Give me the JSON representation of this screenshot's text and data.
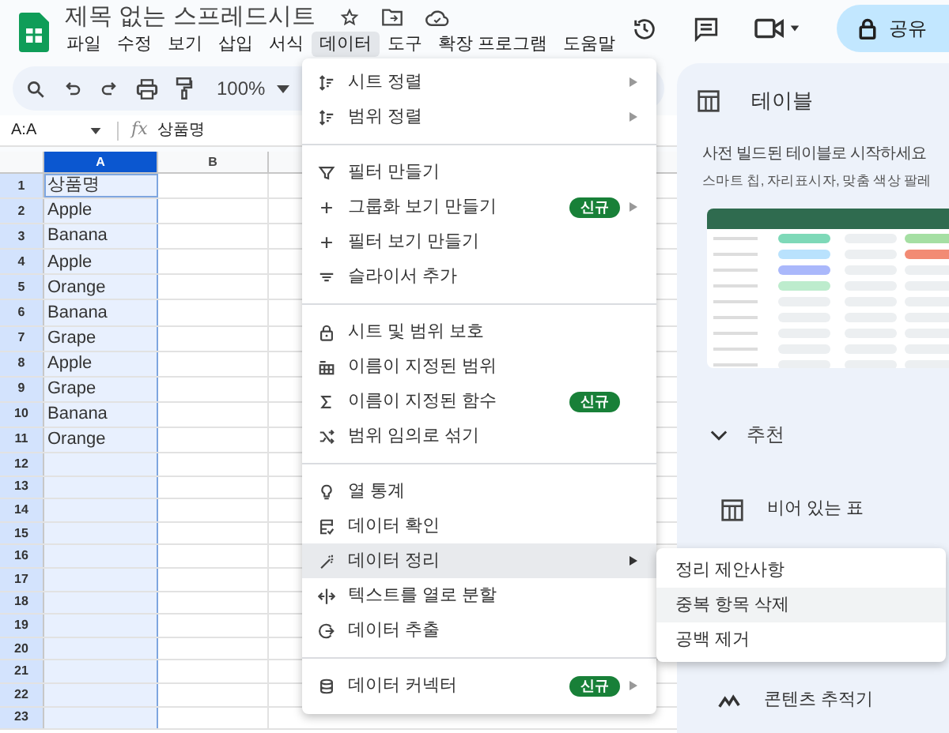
{
  "header": {
    "title": "제목 없는 스프레드시트",
    "menubar": [
      {
        "label": "파일",
        "selected": false
      },
      {
        "label": "수정",
        "selected": false
      },
      {
        "label": "보기",
        "selected": false
      },
      {
        "label": "삽입",
        "selected": false
      },
      {
        "label": "서식",
        "selected": false
      },
      {
        "label": "데이터",
        "selected": true
      },
      {
        "label": "도구",
        "selected": false
      },
      {
        "label": "확장 프로그램",
        "selected": false
      },
      {
        "label": "도움말",
        "selected": false
      }
    ],
    "share_button": "공유"
  },
  "toolbar": {
    "zoom": "100%"
  },
  "formula_bar": {
    "name_box": "A:A",
    "function_label": "fx",
    "content": "상품명"
  },
  "grid": {
    "columns": [
      {
        "label": "A",
        "selected": true
      },
      {
        "label": "B",
        "selected": false
      }
    ],
    "rows": [
      {
        "number": "1",
        "cells": [
          "상품명"
        ]
      },
      {
        "number": "2",
        "cells": [
          "Apple"
        ]
      },
      {
        "number": "3",
        "cells": [
          "Banana"
        ]
      },
      {
        "number": "4",
        "cells": [
          "Apple"
        ]
      },
      {
        "number": "5",
        "cells": [
          "Orange"
        ]
      },
      {
        "number": "6",
        "cells": [
          "Banana"
        ]
      },
      {
        "number": "7",
        "cells": [
          "Grape"
        ]
      },
      {
        "number": "8",
        "cells": [
          "Apple"
        ]
      },
      {
        "number": "9",
        "cells": [
          "Grape"
        ]
      },
      {
        "number": "10",
        "cells": [
          "Banana"
        ]
      },
      {
        "number": "11",
        "cells": [
          "Orange"
        ]
      },
      {
        "number": "12",
        "cells": []
      },
      {
        "number": "13",
        "cells": []
      },
      {
        "number": "14",
        "cells": []
      },
      {
        "number": "15",
        "cells": []
      },
      {
        "number": "16",
        "cells": []
      },
      {
        "number": "17",
        "cells": []
      },
      {
        "number": "18",
        "cells": []
      },
      {
        "number": "19",
        "cells": []
      },
      {
        "number": "20",
        "cells": []
      },
      {
        "number": "21",
        "cells": []
      },
      {
        "number": "22",
        "cells": []
      },
      {
        "number": "23",
        "cells": []
      }
    ]
  },
  "data_menu": {
    "items": [
      {
        "kind": "item",
        "label": "시트 정렬",
        "submenu": true,
        "selected": false
      },
      {
        "kind": "item",
        "label": "범위 정렬",
        "submenu": true,
        "selected": false
      },
      {
        "kind": "separator"
      },
      {
        "kind": "item",
        "label": "필터 만들기",
        "submenu": false,
        "selected": false
      },
      {
        "kind": "item",
        "label": "그룹화 보기 만들기",
        "badge": "신규",
        "submenu": true,
        "selected": false
      },
      {
        "kind": "item",
        "label": "필터 보기 만들기",
        "submenu": false,
        "selected": false
      },
      {
        "kind": "item",
        "label": "슬라이서 추가",
        "submenu": false,
        "selected": false
      },
      {
        "kind": "separator"
      },
      {
        "kind": "item",
        "label": "시트 및 범위 보호",
        "submenu": false,
        "selected": false
      },
      {
        "kind": "item",
        "label": "이름이 지정된 범위",
        "submenu": false,
        "selected": false
      },
      {
        "kind": "item",
        "label": "이름이 지정된 함수",
        "badge": "신규",
        "submenu": false,
        "selected": false
      },
      {
        "kind": "item",
        "label": "범위 임의로 섞기",
        "submenu": false,
        "selected": false
      },
      {
        "kind": "separator"
      },
      {
        "kind": "item",
        "label": "열 통계",
        "submenu": false,
        "selected": false
      },
      {
        "kind": "item",
        "label": "데이터 확인",
        "submenu": false,
        "selected": false
      },
      {
        "kind": "item",
        "label": "데이터 정리",
        "submenu": true,
        "selected": true
      },
      {
        "kind": "item",
        "label": "텍스트를 열로 분할",
        "submenu": false,
        "selected": false
      },
      {
        "kind": "item",
        "label": "데이터 추출",
        "submenu": false,
        "selected": false
      },
      {
        "kind": "separator"
      },
      {
        "kind": "item",
        "label": "데이터 커넥터",
        "badge": "신규",
        "submenu": true,
        "selected": false
      }
    ]
  },
  "cleanup_submenu": {
    "items": [
      {
        "label": "정리 제안사항",
        "selected": false
      },
      {
        "label": "중복 항목 삭제",
        "selected": true
      },
      {
        "label": "공백 제거",
        "selected": false
      }
    ]
  },
  "side_panel": {
    "title": "테이블",
    "description": [
      "사전 빌드된 테이블로 시작하세요",
      "스마트 칩, 자리표시자, 맞춤 색상 팔레"
    ],
    "section": "추천",
    "templates": [
      "비어 있는 표",
      "콘텐츠 추적기"
    ]
  }
}
